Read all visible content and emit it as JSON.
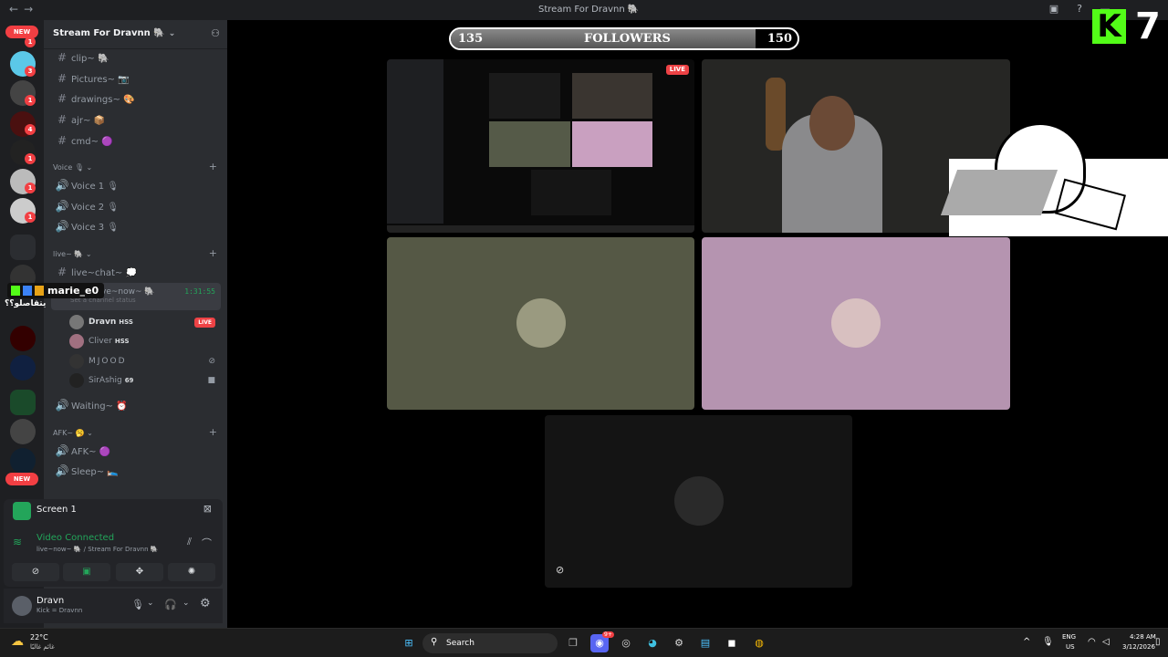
{
  "titlebar": {
    "title": "Stream For Dravnn 🐘",
    "back": "←",
    "forward": "→"
  },
  "servers": {
    "new_top": "NEW",
    "new_bottom": "NEW",
    "badges": [
      "1",
      "3",
      "1",
      "4",
      "1",
      "1",
      "1"
    ]
  },
  "guild": {
    "name": "Stream For Dravnn 🐘"
  },
  "channels": [
    {
      "label": "clip~ 🐘"
    },
    {
      "label": "Pictures~ 📷"
    },
    {
      "label": "drawings~ 🎨"
    },
    {
      "label": "ajr~ 📦"
    },
    {
      "label": "cmd~ 🟣"
    }
  ],
  "voice_category": "Voice 🎙",
  "voice_channels": [
    "Voice 1 🎙",
    "Voice 2 🎙",
    "Voice 3 🎙"
  ],
  "live_category": "live~ 🐘",
  "live_chat": "live~chat~ 💭",
  "live_now": {
    "label": "live~now~ 🐘",
    "timer": "1:31:55",
    "status_placeholder": "Set a channel status"
  },
  "overlay_user": {
    "name": "marie_e0",
    "arabic": "يتقاصلو؟؟"
  },
  "voice_users": [
    {
      "name": "Dravn",
      "tag": "HSS",
      "live": "LIVE"
    },
    {
      "name": "Cliver",
      "tag": "HSS"
    },
    {
      "name": "MJOOD"
    },
    {
      "name": "SirAshig",
      "tag": "69"
    }
  ],
  "waiting": "Waiting~ ⏰",
  "afk_category": "AFK~ 🥱",
  "afk_channels": [
    "AFK~ 🟣",
    "Sleep~ 🛌"
  ],
  "screen_panel": {
    "title": "Screen 1"
  },
  "connection": {
    "status": "Video Connected",
    "detail": "live~now~ 🐘 / Stream For Dravnn 🐘"
  },
  "userbar": {
    "name": "Dravn",
    "sub": "Kick = Dravnn"
  },
  "followers_bar": {
    "start": "135",
    "label": "FOLLOWERS",
    "end": "150",
    "progress": 0.88
  },
  "kick_counter": {
    "letter": "K",
    "count": "7"
  },
  "stream_tile": {
    "live": "LIVE"
  },
  "taskbar": {
    "weather_temp": "22°C",
    "weather_desc": "غائم غالبًا",
    "search": "Search",
    "lang_top": "ENG",
    "lang_bottom": "US",
    "time": "4:28 AM",
    "date": "3/12/2026",
    "discord_badge": "9+"
  }
}
